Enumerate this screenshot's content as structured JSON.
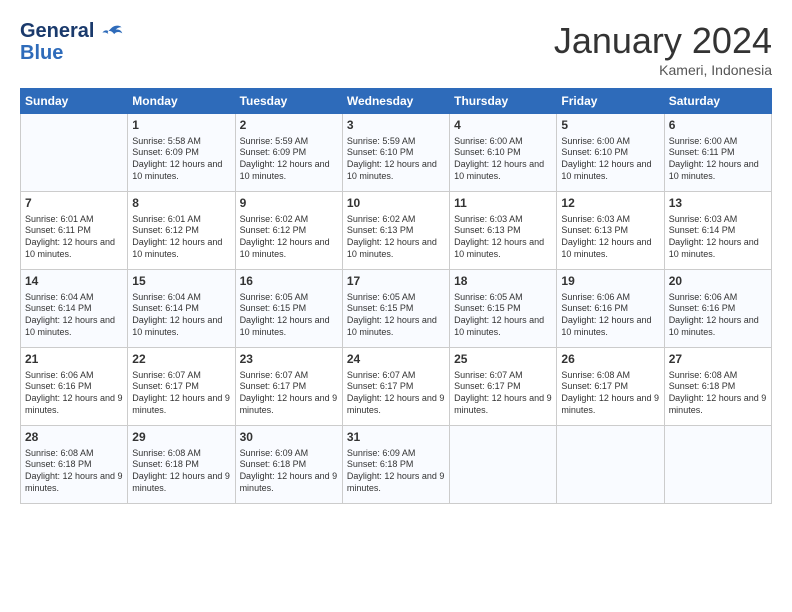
{
  "header": {
    "logo_line1": "General",
    "logo_line2": "Blue",
    "month": "January 2024",
    "location": "Kameri, Indonesia"
  },
  "days_of_week": [
    "Sunday",
    "Monday",
    "Tuesday",
    "Wednesday",
    "Thursday",
    "Friday",
    "Saturday"
  ],
  "weeks": [
    [
      null,
      {
        "day": 1,
        "sunrise": "5:58 AM",
        "sunset": "6:09 PM",
        "daylight": "12 hours and 10 minutes."
      },
      {
        "day": 2,
        "sunrise": "5:59 AM",
        "sunset": "6:09 PM",
        "daylight": "12 hours and 10 minutes."
      },
      {
        "day": 3,
        "sunrise": "5:59 AM",
        "sunset": "6:10 PM",
        "daylight": "12 hours and 10 minutes."
      },
      {
        "day": 4,
        "sunrise": "6:00 AM",
        "sunset": "6:10 PM",
        "daylight": "12 hours and 10 minutes."
      },
      {
        "day": 5,
        "sunrise": "6:00 AM",
        "sunset": "6:10 PM",
        "daylight": "12 hours and 10 minutes."
      },
      {
        "day": 6,
        "sunrise": "6:00 AM",
        "sunset": "6:11 PM",
        "daylight": "12 hours and 10 minutes."
      }
    ],
    [
      {
        "day": 7,
        "sunrise": "6:01 AM",
        "sunset": "6:11 PM",
        "daylight": "12 hours and 10 minutes."
      },
      {
        "day": 8,
        "sunrise": "6:01 AM",
        "sunset": "6:12 PM",
        "daylight": "12 hours and 10 minutes."
      },
      {
        "day": 9,
        "sunrise": "6:02 AM",
        "sunset": "6:12 PM",
        "daylight": "12 hours and 10 minutes."
      },
      {
        "day": 10,
        "sunrise": "6:02 AM",
        "sunset": "6:13 PM",
        "daylight": "12 hours and 10 minutes."
      },
      {
        "day": 11,
        "sunrise": "6:03 AM",
        "sunset": "6:13 PM",
        "daylight": "12 hours and 10 minutes."
      },
      {
        "day": 12,
        "sunrise": "6:03 AM",
        "sunset": "6:13 PM",
        "daylight": "12 hours and 10 minutes."
      },
      {
        "day": 13,
        "sunrise": "6:03 AM",
        "sunset": "6:14 PM",
        "daylight": "12 hours and 10 minutes."
      }
    ],
    [
      {
        "day": 14,
        "sunrise": "6:04 AM",
        "sunset": "6:14 PM",
        "daylight": "12 hours and 10 minutes."
      },
      {
        "day": 15,
        "sunrise": "6:04 AM",
        "sunset": "6:14 PM",
        "daylight": "12 hours and 10 minutes."
      },
      {
        "day": 16,
        "sunrise": "6:05 AM",
        "sunset": "6:15 PM",
        "daylight": "12 hours and 10 minutes."
      },
      {
        "day": 17,
        "sunrise": "6:05 AM",
        "sunset": "6:15 PM",
        "daylight": "12 hours and 10 minutes."
      },
      {
        "day": 18,
        "sunrise": "6:05 AM",
        "sunset": "6:15 PM",
        "daylight": "12 hours and 10 minutes."
      },
      {
        "day": 19,
        "sunrise": "6:06 AM",
        "sunset": "6:16 PM",
        "daylight": "12 hours and 10 minutes."
      },
      {
        "day": 20,
        "sunrise": "6:06 AM",
        "sunset": "6:16 PM",
        "daylight": "12 hours and 10 minutes."
      }
    ],
    [
      {
        "day": 21,
        "sunrise": "6:06 AM",
        "sunset": "6:16 PM",
        "daylight": "12 hours and 9 minutes."
      },
      {
        "day": 22,
        "sunrise": "6:07 AM",
        "sunset": "6:17 PM",
        "daylight": "12 hours and 9 minutes."
      },
      {
        "day": 23,
        "sunrise": "6:07 AM",
        "sunset": "6:17 PM",
        "daylight": "12 hours and 9 minutes."
      },
      {
        "day": 24,
        "sunrise": "6:07 AM",
        "sunset": "6:17 PM",
        "daylight": "12 hours and 9 minutes."
      },
      {
        "day": 25,
        "sunrise": "6:07 AM",
        "sunset": "6:17 PM",
        "daylight": "12 hours and 9 minutes."
      },
      {
        "day": 26,
        "sunrise": "6:08 AM",
        "sunset": "6:17 PM",
        "daylight": "12 hours and 9 minutes."
      },
      {
        "day": 27,
        "sunrise": "6:08 AM",
        "sunset": "6:18 PM",
        "daylight": "12 hours and 9 minutes."
      }
    ],
    [
      {
        "day": 28,
        "sunrise": "6:08 AM",
        "sunset": "6:18 PM",
        "daylight": "12 hours and 9 minutes."
      },
      {
        "day": 29,
        "sunrise": "6:08 AM",
        "sunset": "6:18 PM",
        "daylight": "12 hours and 9 minutes."
      },
      {
        "day": 30,
        "sunrise": "6:09 AM",
        "sunset": "6:18 PM",
        "daylight": "12 hours and 9 minutes."
      },
      {
        "day": 31,
        "sunrise": "6:09 AM",
        "sunset": "6:18 PM",
        "daylight": "12 hours and 9 minutes."
      },
      null,
      null,
      null
    ]
  ]
}
